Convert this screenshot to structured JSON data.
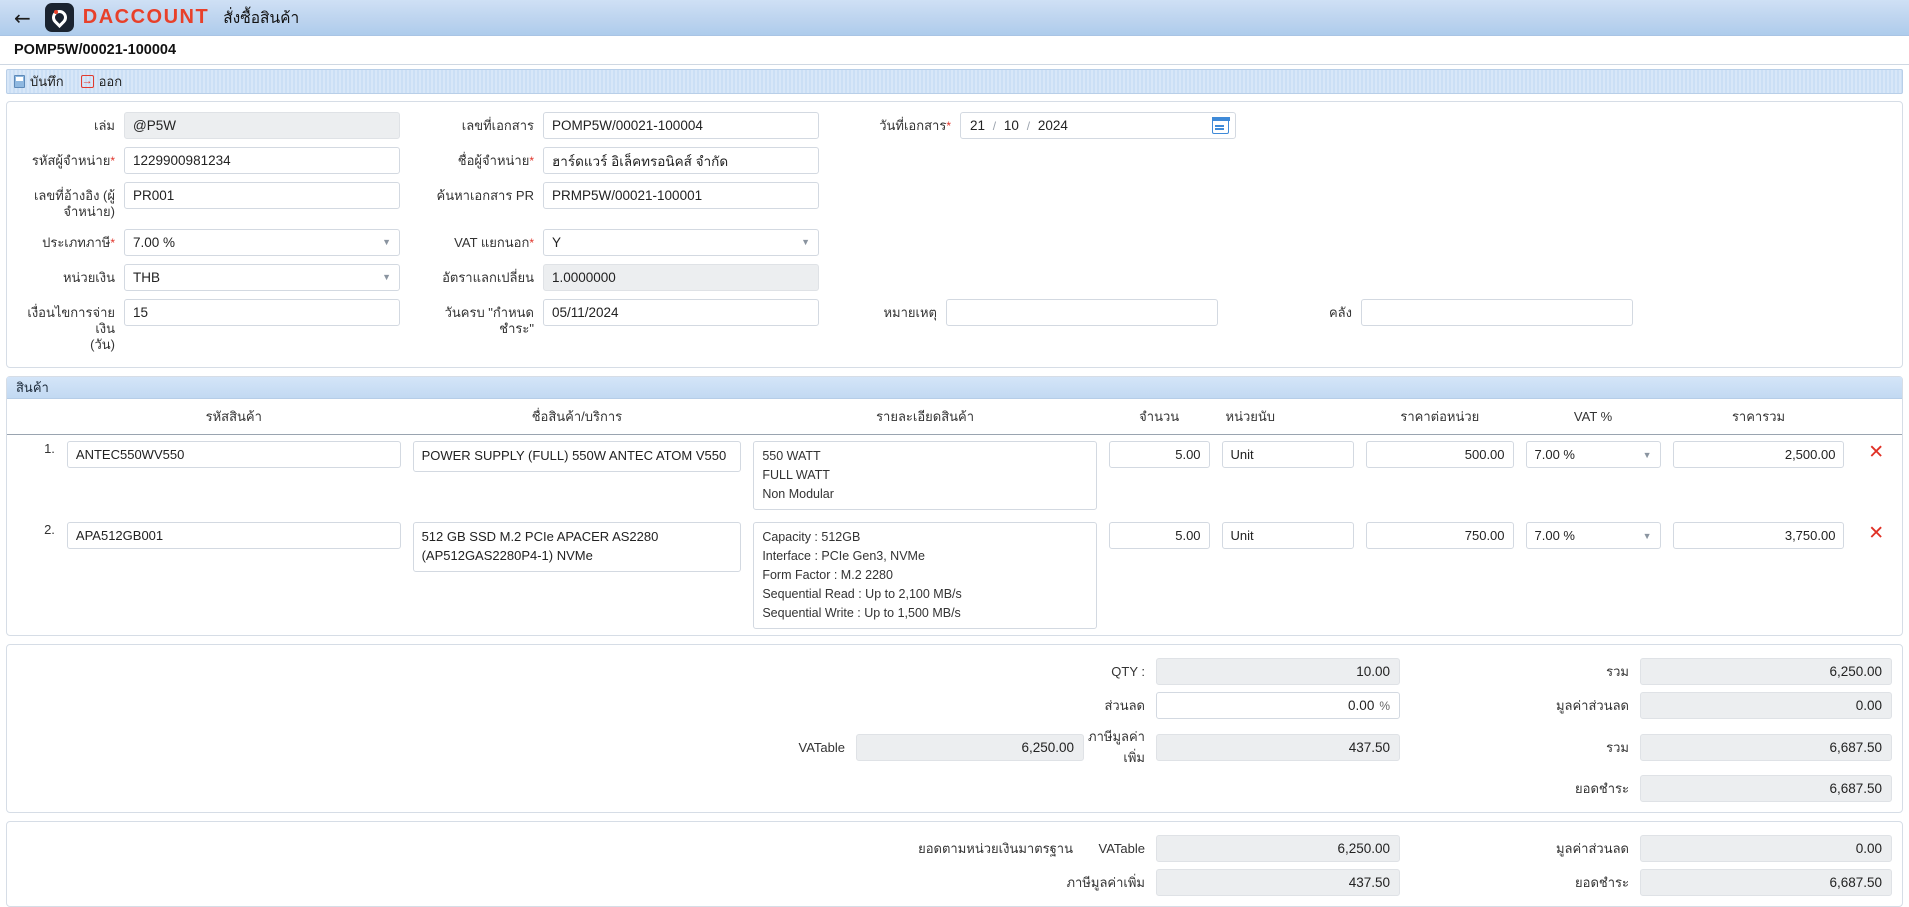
{
  "appbar": {
    "back_icon": "back-arrow-icon",
    "brand": "DACCOUNT",
    "title": "สั่งซื้อสินค้า"
  },
  "document": {
    "number": "POMP5W/00021-100004"
  },
  "toolbar": {
    "save_label": "บันทึก",
    "exit_label": "ออก"
  },
  "form": {
    "volume": {
      "label": "เล่ม",
      "value": "@P5W",
      "readonly": true
    },
    "doc_no": {
      "label": "เลขที่เอกสาร",
      "value": "POMP5W/00021-100004"
    },
    "doc_date": {
      "label": "วันที่เอกสาร",
      "required": true,
      "day": "21",
      "month": "10",
      "year": "2024",
      "sep": "/"
    },
    "vendor_code": {
      "label": "รหัสผู้จำหน่าย",
      "required": true,
      "value": "1229900981234"
    },
    "vendor_name": {
      "label": "ชื่อผู้จำหน่าย",
      "required": true,
      "value": "ฮาร์ดแวร์ อิเล็คทรอนิคส์ จำกัด"
    },
    "reference_no": {
      "label": "เลขที่อ้างอิง (ผู้\nจำหน่าย)",
      "value": "PR001"
    },
    "search_pr": {
      "label": "ค้นหาเอกสาร PR",
      "value": "PRMP5W/00021-100001"
    },
    "tax_type": {
      "label": "ประเภทภาษี",
      "required": true,
      "value": "7.00 %"
    },
    "vat_excluded": {
      "label": "VAT แยกนอก",
      "required": true,
      "value": "Y"
    },
    "currency": {
      "label": "หน่วยเงิน",
      "value": "THB"
    },
    "exchange_rate": {
      "label": "อัตราแลกเปลี่ยน",
      "value": "1.0000000",
      "readonly": true
    },
    "payment_terms": {
      "label": "เงื่อนไขการจ่ายเงิน\n(วัน)",
      "value": "15"
    },
    "due_date": {
      "label": "วันครบ \"กำหนดชำระ\"",
      "value": "05/11/2024"
    },
    "remark": {
      "label": "หมายเหตุ",
      "value": ""
    },
    "warehouse": {
      "label": "คลัง",
      "value": ""
    }
  },
  "items_section": {
    "title": "สินค้า",
    "columns": {
      "code": "รหัสสินค้า",
      "name": "ชื่อสินค้า/บริการ",
      "detail": "รายละเอียดสินค้า",
      "qty": "จำนวน",
      "unit": "หน่วยนับ",
      "unit_price": "ราคาต่อหน่วย",
      "vat_pct": "VAT %",
      "total": "ราคารวม"
    },
    "rows": [
      {
        "index": "1.",
        "code": "ANTEC550WV550",
        "name": "POWER SUPPLY (FULL) 550W ANTEC ATOM V550",
        "detail": "550 WATT\nFULL WATT\nNon Modular",
        "qty": "5.00",
        "unit": "Unit",
        "unit_price": "500.00",
        "vat_pct": "7.00 %",
        "total": "2,500.00",
        "delete_icon": "delete-row-icon"
      },
      {
        "index": "2.",
        "code": "APA512GB001",
        "name": "512 GB SSD M.2 PCIe APACER AS2280 (AP512GAS2280P4-1) NVMe",
        "detail": "Capacity : 512GB\nInterface : PCIe Gen3, NVMe\nForm Factor : M.2 2280\nSequential Read : Up to 2,100 MB/s\nSequential Write : Up to 1,500 MB/s",
        "qty": "5.00",
        "unit": "Unit",
        "unit_price": "750.00",
        "vat_pct": "7.00 %",
        "total": "3,750.00",
        "delete_icon": "delete-row-icon"
      }
    ]
  },
  "summary": {
    "qty_label": "QTY :",
    "qty_value": "10.00",
    "total_label": "รวม",
    "total_value": "6,250.00",
    "discount_label": "ส่วนลด",
    "discount_value": "0.00",
    "discount_unit": "%",
    "discount_amount_label": "มูลค่าส่วนลด",
    "discount_amount_value": "0.00",
    "vatable_label": "VATable",
    "vatable_value": "6,250.00",
    "vat_label": "ภาษีมูลค่าเพิ่ม",
    "vat_value": "437.50",
    "net_label": "รวม",
    "net_value": "6,687.50",
    "payable_label": "ยอดชำระ",
    "payable_value": "6,687.50"
  },
  "base_summary": {
    "title": "ยอดตามหน่วยเงินมาตรฐาน",
    "vatable_label": "VATable",
    "vatable_value": "6,250.00",
    "discount_amount_label": "มูลค่าส่วนลด",
    "discount_amount_value": "0.00",
    "vat_label": "ภาษีมูลค่าเพิ่ม",
    "vat_value": "437.50",
    "payable_label": "ยอดชำระ",
    "payable_value": "6,687.50"
  }
}
